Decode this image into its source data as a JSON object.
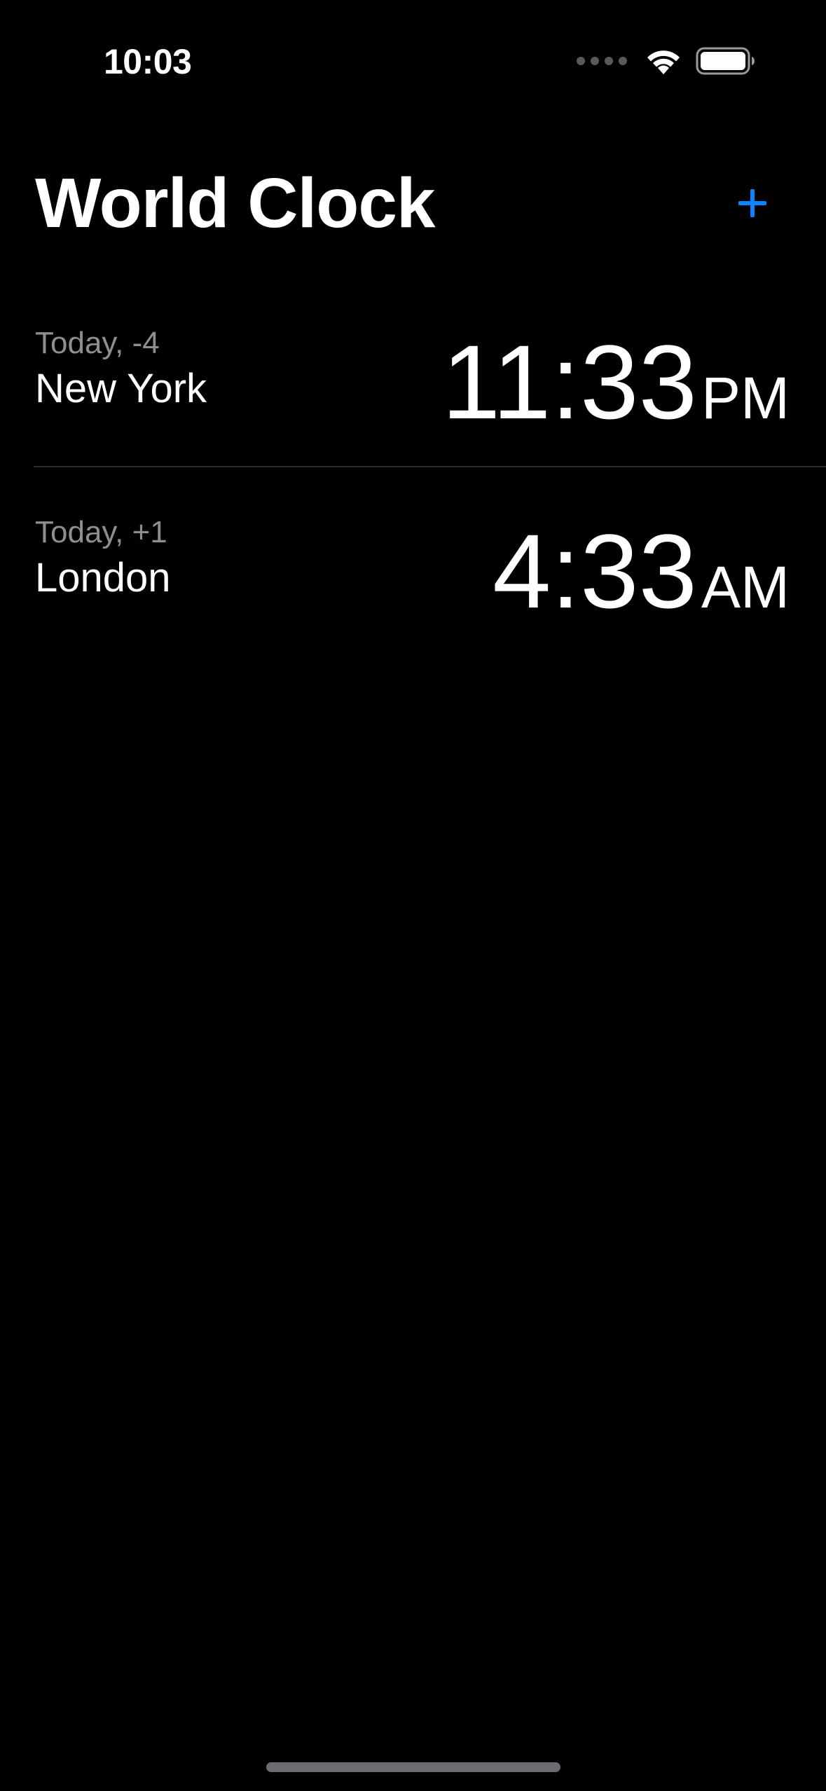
{
  "status_bar": {
    "time": "10:03",
    "icons": [
      "cellular-signal-icon",
      "wifi-icon",
      "battery-icon"
    ]
  },
  "header": {
    "title": "World Clock",
    "add_button_icon": "plus-icon",
    "accent_color": "#0a84ff"
  },
  "clocks": [
    {
      "offset": "Today, -4",
      "city": "New York",
      "time": "11:33",
      "ampm": "PM"
    },
    {
      "offset": "Today, +1",
      "city": "London",
      "time": "4:33",
      "ampm": "AM"
    }
  ],
  "colors": {
    "background": "#000000",
    "primary_text": "#ffffff",
    "secondary_text": "#8d8d92",
    "separator": "#2a2a2c"
  }
}
